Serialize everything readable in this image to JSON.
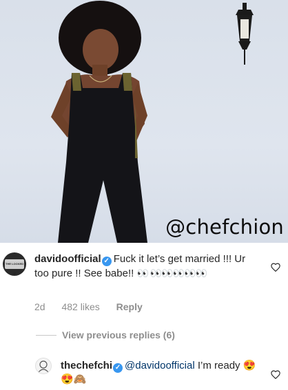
{
  "photo": {
    "watermark": "@chefchion",
    "colors": {
      "background": "#dbe1eb",
      "outfit": "#141418",
      "skin": "#7a4a33",
      "hair": "#151010"
    }
  },
  "comments": [
    {
      "username": "davidoofficial",
      "verified": true,
      "text": "Fuck it let’s get married !!! Ur too pure !! See babe!!",
      "emojis": "👀 👀👀👀👀👀",
      "time": "2d",
      "likes": "482 likes",
      "reply_label": "Reply"
    }
  ],
  "view_replies": "View previous replies (6)",
  "reply": {
    "username": "thechefchi",
    "verified": true,
    "mention": "@davidoofficial",
    "text": "I’m ready",
    "emojis": "😍😍🙈"
  },
  "colors": {
    "verified": "#3897f0",
    "meta": "#8e8e8e",
    "mention": "#003569",
    "text": "#262626"
  },
  "icons": [
    "heart-outline-icon",
    "verified-badge-icon"
  ]
}
